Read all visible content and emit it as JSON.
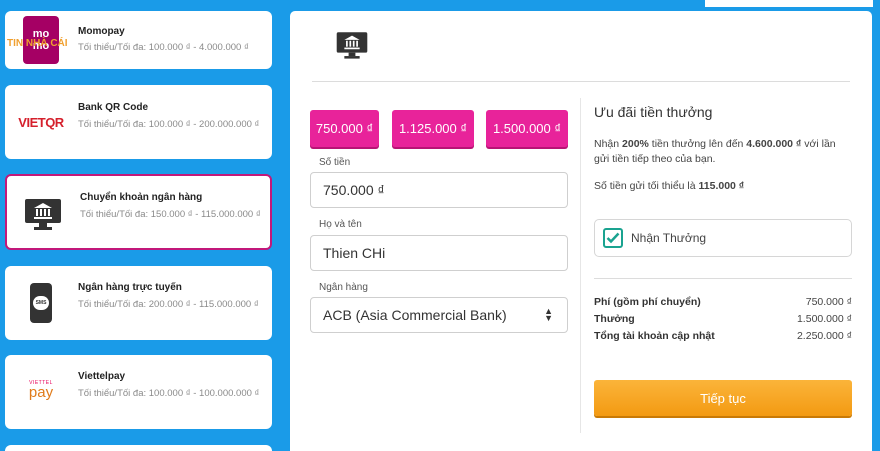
{
  "sidebar": {
    "methods": [
      {
        "name": "Momopay",
        "limit": "Tối thiểu/Tối đa: 100.000 ₫ - 4.000.000 ₫",
        "icon": "momo-logo",
        "logo_text": "mo mo",
        "watermark": "TIN NHÀ CÁI"
      },
      {
        "name": "Bank QR Code",
        "limit": "Tối thiểu/Tối đa: 100.000 ₫ - 200.000.000 ₫",
        "icon": "vietqr-logo",
        "logo_text": "VIETQR"
      },
      {
        "name": "Chuyển khoản ngân hàng",
        "limit": "Tối thiểu/Tối đa: 150.000 ₫ - 115.000.000 ₫",
        "icon": "bank-transfer-icon",
        "active": true
      },
      {
        "name": "Ngân hàng trực tuyến",
        "limit": "Tối thiểu/Tối đa: 200.000 ₫ - 115.000.000 ₫",
        "icon": "mobile-sms-icon",
        "icon_text": "SMS"
      },
      {
        "name": "Viettelpay",
        "limit": "Tối thiểu/Tối đa: 100.000 ₫ - 100.000.000 ₫",
        "icon": "viettelpay-logo",
        "logo_text": "pay",
        "logo_small": "VIETTEL"
      }
    ]
  },
  "form": {
    "amount_buttons": [
      "750.000 ₫",
      "1.125.000 ₫",
      "1.500.000 ₫"
    ],
    "amount_label": "Số tiền",
    "amount_value": "750.000 ₫",
    "name_label": "Họ và tên",
    "name_value": "Thien CHi",
    "bank_label": "Ngân hàng",
    "bank_value": "ACB (Asia Commercial Bank)"
  },
  "bonus": {
    "title": "Ưu đãi tiền thưởng",
    "desc_prefix": "Nhận ",
    "desc_percent": "200%",
    "desc_mid": " tiền thưởng lên đến ",
    "desc_max": "4.600.000 ₫",
    "desc_suffix": " với lần gửi tiền tiếp theo của bạn.",
    "min_prefix": "Số tiền gửi tối thiểu là ",
    "min_value": "115.000 ₫",
    "checkbox_label": "Nhận Thưởng",
    "checked": true
  },
  "summary": {
    "rows": [
      {
        "label": "Phí (gồm phí chuyển)",
        "value": "750.000 ₫"
      },
      {
        "label": "Thưởng",
        "value": "1.500.000 ₫"
      },
      {
        "label": "Tổng tài khoản cập nhật",
        "value": "2.250.000 ₫"
      }
    ]
  },
  "continue_label": "Tiếp tục",
  "colors": {
    "background": "#1a9be8",
    "accent_pink": "#e8239a",
    "active_border": "#c2187a",
    "button_orange": "#f5a623",
    "check_teal": "#1aa390"
  }
}
